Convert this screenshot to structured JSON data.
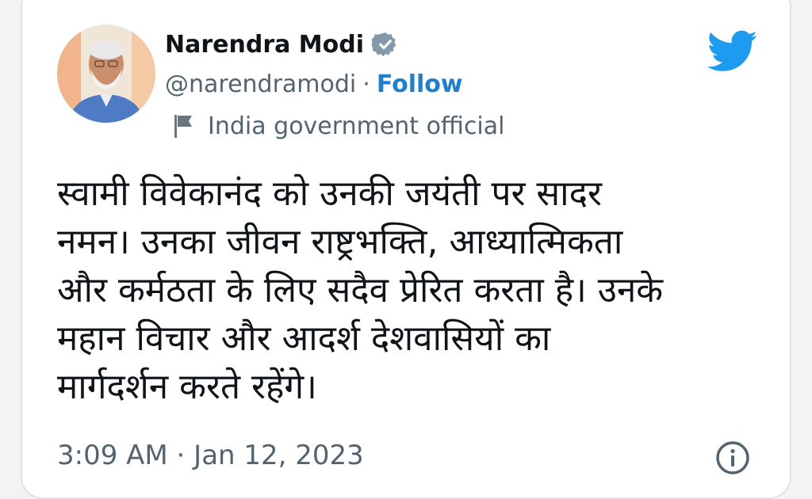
{
  "tweet": {
    "author": {
      "display_name": "Narendra Modi",
      "handle": "@narendramodi",
      "verified": true,
      "follow_label": "Follow",
      "separator": "·",
      "affiliation_label": "India government official"
    },
    "text": "स्वामी विवेकानंद को उनकी जयंती पर सादर\nनमन। उनका जीवन राष्ट्रभक्ति, आध्यात्मिकता\nऔर कर्मठता के लिए सदैव प्रेरित करता है। उनके\nमहान विचार और आदर्श देशवासियों का\nमार्गदर्शन करते रहेंगे।",
    "timestamp": "3:09 AM · Jan 12, 2023"
  },
  "icons": {
    "brand": "twitter-bird-icon",
    "verified": "verified-badge-icon",
    "affiliation": "flag-icon",
    "info": "info-icon"
  },
  "colors": {
    "twitter_blue": "#1d9bf0",
    "follow_blue": "#1d7fd0",
    "text_primary": "#0f1419",
    "text_secondary": "#536471",
    "verified_badge": "#829aab"
  }
}
